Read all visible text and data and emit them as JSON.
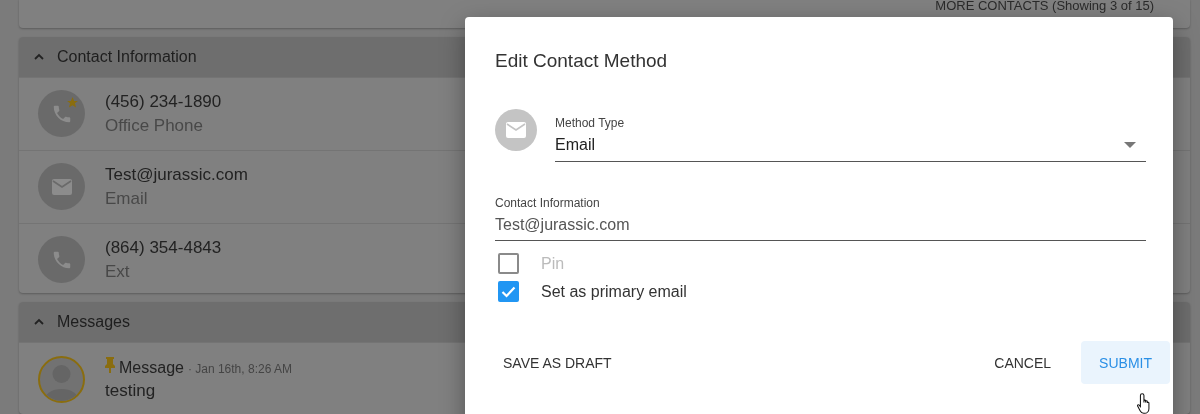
{
  "background_page": {
    "more_contacts": "MORE CONTACTS (Showing 3 of 15)",
    "sections": [
      {
        "title": "Contact Information",
        "expanded": true,
        "items": [
          {
            "kind": "phone",
            "primary": "(456) 234-1890",
            "secondary": "Office Phone",
            "starred": true
          },
          {
            "kind": "email",
            "primary": "Test@jurassic.com",
            "secondary": "Email",
            "starred": false
          },
          {
            "kind": "phone",
            "primary": "(864) 354-4843",
            "secondary": "Ext",
            "starred": false
          }
        ]
      },
      {
        "title": "Messages",
        "expanded": true,
        "items": [
          {
            "kind": "message",
            "pinned": true,
            "title": "Message",
            "time": "· Jan 16th, 8:26 AM",
            "body": "testing"
          }
        ]
      }
    ]
  },
  "dialog": {
    "title": "Edit Contact Method",
    "method_type": {
      "kind": "email",
      "label": "Method Type",
      "value": "Email"
    },
    "contact_information": {
      "label": "Contact Information",
      "value": "Test@jurassic.com"
    },
    "checkboxes": [
      {
        "label": "Pin",
        "checked": false,
        "disabled": true
      },
      {
        "label": "Set as primary email",
        "checked": true,
        "disabled": false
      }
    ],
    "left_buttons": [
      {
        "label": "SAVE AS DRAFT",
        "kind": "plain",
        "hovered": false
      }
    ],
    "right_buttons": [
      {
        "label": "CANCEL",
        "kind": "plain",
        "hovered": false
      },
      {
        "label": "SUBMIT",
        "kind": "primary",
        "hovered": true
      }
    ]
  }
}
